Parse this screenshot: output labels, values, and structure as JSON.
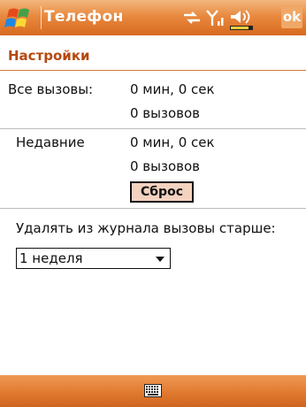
{
  "titlebar": {
    "app_title": "Телефон",
    "ok_label": "ok"
  },
  "header": {
    "title": "Настройки"
  },
  "all_calls": {
    "label": "Все вызовы:",
    "duration": "0 мин, 0 сек",
    "count": "0 вызовов"
  },
  "recent": {
    "label": "Недавние",
    "duration": "0 мин, 0 сек",
    "count": "0 вызовов",
    "reset_label": "Сброс"
  },
  "log": {
    "label": "Удалять из журнала вызовы старше:",
    "selected": "1 неделя"
  },
  "icons": [
    "windows-start-icon",
    "connectivity-icon",
    "signal-icon",
    "volume-icon",
    "battery-icon",
    "keyboard-icon"
  ],
  "colors": {
    "accent": "#d86a1e",
    "title_text": "#b5480f"
  }
}
